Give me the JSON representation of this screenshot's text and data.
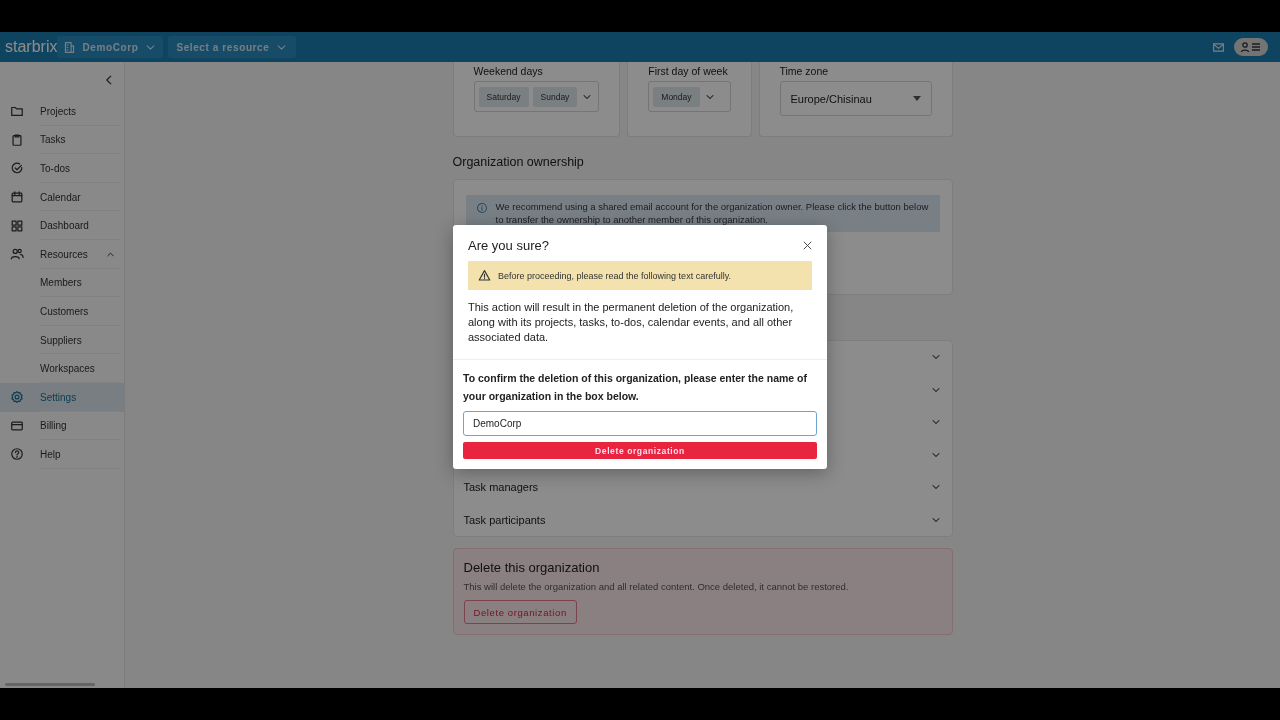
{
  "topbar": {
    "logo": "starbrix",
    "organization": "DemoCorp",
    "resource_select": {
      "placeholder": "Select a resource"
    }
  },
  "sidebar": {
    "items": [
      {
        "label": "Projects",
        "selected": false
      },
      {
        "label": "Tasks",
        "selected": false
      },
      {
        "label": "To-dos",
        "selected": false
      },
      {
        "label": "Calendar",
        "selected": false
      },
      {
        "label": "Dashboard",
        "selected": false
      },
      {
        "label": "Resources",
        "selected": false,
        "expanded": true,
        "children": [
          {
            "label": "Members",
            "selected": false
          },
          {
            "label": "Customers",
            "selected": false
          },
          {
            "label": "Suppliers",
            "selected": false
          },
          {
            "label": "Workspaces",
            "selected": false
          }
        ]
      },
      {
        "label": "Settings",
        "selected": true
      },
      {
        "label": "Billing",
        "selected": false
      },
      {
        "label": "Help",
        "selected": false
      }
    ]
  },
  "calendar_settings": {
    "weekend_days": {
      "label": "Weekend days",
      "values": [
        "Saturday",
        "Sunday"
      ]
    },
    "first_day_of_week": {
      "label": "First day of week",
      "values": [
        "Monday"
      ]
    },
    "time_zone": {
      "label": "Time zone",
      "value": "Europe/Chisinau"
    }
  },
  "ownership": {
    "title": "Organization ownership",
    "info": "We recommend using a shared email account for the organization owner. Please click the button below to transfer the ownership to another member of this organization."
  },
  "role_rows": [
    {
      "expanded": false
    },
    {
      "expanded": false
    },
    {
      "expanded": false
    },
    {
      "expanded": false
    },
    {
      "label": "Task managers",
      "expanded": false
    },
    {
      "label": "Task participants",
      "expanded": false
    }
  ],
  "danger_zone": {
    "title": "Delete this organization",
    "description": "This will delete the organization and all related content. Once deleted, it cannot be restored.",
    "button": "Delete organization"
  },
  "dialog": {
    "title": "Are you sure?",
    "warning": "Before proceeding, please read the following text carefully.",
    "body": "This action will result in the permanent deletion of the organization, along with its projects, tasks, to-dos, calendar events, and all other associated data.",
    "prompt": "To confirm the deletion of this organization, please enter the name of your organization in the box below.",
    "value": "DemoCorp",
    "confirm_button": "Delete organization"
  }
}
